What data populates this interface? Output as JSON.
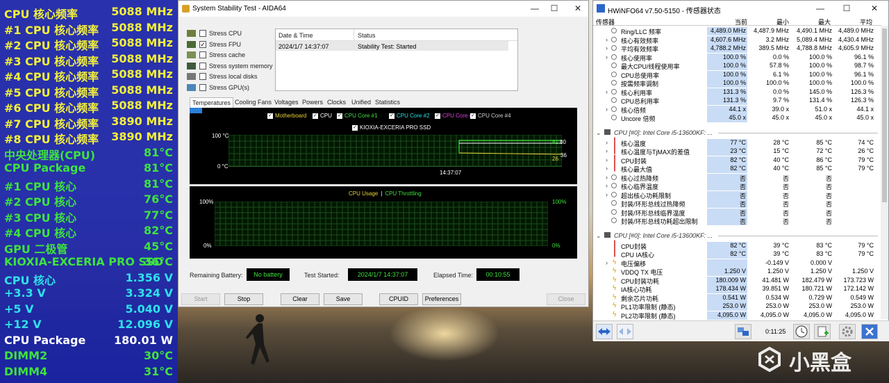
{
  "osd": [
    {
      "label": "CPU 核心频率",
      "value": "5088 MHz",
      "color": "yellow"
    },
    {
      "label": "#1 CPU 核心频率",
      "value": "5088 MHz",
      "color": "yellow"
    },
    {
      "label": "#2 CPU 核心频率",
      "value": "5088 MHz",
      "color": "yellow"
    },
    {
      "label": "#3 CPU 核心频率",
      "value": "5088 MHz",
      "color": "yellow"
    },
    {
      "label": "#4 CPU 核心频率",
      "value": "5088 MHz",
      "color": "yellow"
    },
    {
      "label": "#5 CPU 核心频率",
      "value": "5088 MHz",
      "color": "yellow"
    },
    {
      "label": "#6 CPU 核心频率",
      "value": "5088 MHz",
      "color": "yellow"
    },
    {
      "label": "#7 CPU 核心频率",
      "value": "3890 MHz",
      "color": "yellow"
    },
    {
      "label": "#8 CPU 核心频率",
      "value": "3890 MHz",
      "color": "yellow"
    },
    {
      "label": "中央处理器(CPU)",
      "value": "81°C",
      "color": "green"
    },
    {
      "label": "CPU Package",
      "value": "81°C",
      "color": "green"
    },
    {
      "label": " #1 CPU 核心",
      "value": "81°C",
      "color": "green"
    },
    {
      "label": " #2 CPU 核心",
      "value": "76°C",
      "color": "green"
    },
    {
      "label": " #3 CPU 核心",
      "value": "77°C",
      "color": "green"
    },
    {
      "label": " #4 CPU 核心",
      "value": "82°C",
      "color": "green"
    },
    {
      "label": "GPU 二极管",
      "value": "45°C",
      "color": "green"
    },
    {
      "label": "KIOXIA-EXCERIA PRO SSD",
      "value": "36°C",
      "color": "green"
    },
    {
      "label": "CPU 核心",
      "value": "1.356 V",
      "color": "cyan"
    },
    {
      "label": "+3.3 V",
      "value": "3.324 V",
      "color": "cyan"
    },
    {
      "label": "+5 V",
      "value": "5.040 V",
      "color": "cyan"
    },
    {
      "label": "+12 V",
      "value": "12.096 V",
      "color": "cyan"
    },
    {
      "label": "CPU Package",
      "value": "180.01 W",
      "color": "white"
    },
    {
      "label": "DIMM2",
      "value": "30°C",
      "color": "green"
    },
    {
      "label": "DIMM4",
      "value": "31°C",
      "color": "green"
    }
  ],
  "aida": {
    "title": "System Stability Test - AIDA64",
    "win_min": "—",
    "win_max": "☐",
    "win_close": "✕",
    "stress": [
      {
        "label": "Stress CPU",
        "checked": false
      },
      {
        "label": "Stress FPU",
        "checked": true
      },
      {
        "label": "Stress cache",
        "checked": false
      },
      {
        "label": "Stress system memory",
        "checked": false
      },
      {
        "label": "Stress local disks",
        "checked": false
      },
      {
        "label": "Stress GPU(s)",
        "checked": false
      }
    ],
    "table": {
      "col_date": "Date & Time",
      "col_status": "Status",
      "row_date": "2024/1/7 14:37:07",
      "row_status": "Stability Test: Started"
    },
    "tabs": [
      "Temperatures",
      "Cooling Fans",
      "Voltages",
      "Powers",
      "Clocks",
      "Unified",
      "Statistics"
    ],
    "temp_graph": {
      "legend": [
        "Motherboard",
        "CPU",
        "CPU Core #1",
        "CPU Core #2",
        "CPU Core #3",
        "CPU Core #4"
      ],
      "legend2": "KIOXIA-EXCERIA PRO SSD",
      "y_top": "100 °C",
      "y_bottom": "0 °C",
      "time": "14:37:07",
      "val_hi": "81",
      "val_hi2": "80",
      "val_lo": "26",
      "val_lo2": "36"
    },
    "cpu_graph": {
      "label_usage": "CPU Usage",
      "sep": "|",
      "label_throttle": "CPU Throttling",
      "y_top": "100%",
      "y_bottom": "0%",
      "r_top": "100%",
      "r_bottom": "0%"
    },
    "status": {
      "battery_label": "Remaining Battery:",
      "battery_value": "No battery",
      "started_label": "Test Started:",
      "started_value": "2024/1/7 14:37:07",
      "elapsed_label": "Elapsed Time:",
      "elapsed_value": "00:10:55"
    },
    "buttons": {
      "start": "Start",
      "stop": "Stop",
      "clear": "Clear",
      "save": "Save",
      "cpuid": "CPUID",
      "prefs": "Preferences",
      "close": "Close"
    }
  },
  "hwinfo": {
    "title": "HWiNFO64 v7.50-5150 - 传感器状态",
    "win_min": "—",
    "win_max": "☐",
    "win_close": "✕",
    "header": {
      "sensor": "传感器",
      "current": "当前",
      "min": "最小",
      "max": "最大",
      "avg": "平均"
    },
    "group1": [
      {
        "name": "Ring/LLC 频率",
        "cur": "4,489.0 MHz",
        "min": "4,487.9 MHz",
        "max": "4,490.1 MHz",
        "avg": "4,489.0 MHz"
      },
      {
        "name": "核心有效频率",
        "cur": "4,607.6 MHz",
        "min": "3.2 MHz",
        "max": "5,089.4 MHz",
        "avg": "4,430.4 MHz"
      },
      {
        "name": "平均有效频率",
        "cur": "4,788.2 MHz",
        "min": "389.5 MHz",
        "max": "4,788.8 MHz",
        "avg": "4,605.9 MHz"
      },
      {
        "name": "核心使用率",
        "cur": "100.0 %",
        "min": "0.0 %",
        "max": "100.0 %",
        "avg": "96.1 %"
      },
      {
        "name": "最大CPU/线程使用率",
        "cur": "100.0 %",
        "min": "57.8 %",
        "max": "100.0 %",
        "avg": "98.7 %"
      },
      {
        "name": "CPU总使用率",
        "cur": "100.0 %",
        "min": "6.1 %",
        "max": "100.0 %",
        "avg": "96.1 %"
      },
      {
        "name": "按需频率调制",
        "cur": "100.0 %",
        "min": "100.0 %",
        "max": "100.0 %",
        "avg": "100.0 %"
      },
      {
        "name": "核心利用率",
        "cur": "131.3 %",
        "min": "0.0 %",
        "max": "145.0 %",
        "avg": "126.3 %"
      },
      {
        "name": "CPU总利用率",
        "cur": "131.3 %",
        "min": "9.7 %",
        "max": "131.4 %",
        "avg": "126.3 %"
      },
      {
        "name": "核心倍频",
        "cur": "44.1 x",
        "min": "39.0 x",
        "max": "51.0 x",
        "avg": "44.1 x"
      },
      {
        "name": "Uncore 倍频",
        "cur": "45.0 x",
        "min": "45.0 x",
        "max": "45.0 x",
        "avg": "45.0 x"
      }
    ],
    "group2_title": "CPU [#0]: Intel Core i5-13600KF: ...",
    "group2": [
      {
        "name": "核心温度",
        "cur": "77 °C",
        "min": "28 °C",
        "max": "85 °C",
        "avg": "74 °C"
      },
      {
        "name": "核心温度与TjMAX的差值",
        "cur": "23 °C",
        "min": "15 °C",
        "max": "72 °C",
        "avg": "26 °C"
      },
      {
        "name": "CPU封装",
        "cur": "82 °C",
        "min": "40 °C",
        "max": "86 °C",
        "avg": "79 °C"
      },
      {
        "name": "核心最大值",
        "cur": "82 °C",
        "min": "40 °C",
        "max": "85 °C",
        "avg": "79 °C"
      },
      {
        "name": "核心过热降频",
        "cur": "否",
        "min": "否",
        "max": "否",
        "avg": ""
      },
      {
        "name": "核心临界温度",
        "cur": "否",
        "min": "否",
        "max": "否",
        "avg": ""
      },
      {
        "name": "超出核心功耗限制",
        "cur": "否",
        "min": "否",
        "max": "否",
        "avg": ""
      },
      {
        "name": "封装/环形总线过热降频",
        "cur": "否",
        "min": "否",
        "max": "否",
        "avg": ""
      },
      {
        "name": "封装/环形总线临界温度",
        "cur": "否",
        "min": "否",
        "max": "否",
        "avg": ""
      },
      {
        "name": "封装/环形总线功耗超出限制",
        "cur": "否",
        "min": "否",
        "max": "否",
        "avg": ""
      }
    ],
    "group3_title": "CPU [#0]: Intel Core i5-13600KF: ...",
    "group3": [
      {
        "name": "CPU封装",
        "cur": "82 °C",
        "min": "39 °C",
        "max": "83 °C",
        "avg": "79 °C"
      },
      {
        "name": "CPU IA核心",
        "cur": "82 °C",
        "min": "39 °C",
        "max": "83 °C",
        "avg": "79 °C"
      },
      {
        "name": "电压偏移",
        "cur": "",
        "min": "-0.149 V",
        "max": "0.000 V",
        "avg": ""
      },
      {
        "name": "VDDQ TX 电压",
        "cur": "1.250 V",
        "min": "1.250 V",
        "max": "1.250 V",
        "avg": "1.250 V"
      },
      {
        "name": "CPU封装功耗",
        "cur": "180.009 W",
        "min": "41.481 W",
        "max": "182.479 W",
        "avg": "173.723 W"
      },
      {
        "name": "IA核心功耗",
        "cur": "178.434 W",
        "min": "39.851 W",
        "max": "180.721 W",
        "avg": "172.142 W"
      },
      {
        "name": "剩余芯片功耗",
        "cur": "0.541 W",
        "min": "0.534 W",
        "max": "0.729 W",
        "avg": "0.549 W"
      },
      {
        "name": "PL1功率限制 (静态)",
        "cur": "253.0 W",
        "min": "253.0 W",
        "max": "253.0 W",
        "avg": "253.0 W"
      },
      {
        "name": "PL2功率限制 (静态)",
        "cur": "4,095.0 W",
        "min": "4,095.0 W",
        "max": "4,095.0 W",
        "avg": "4,095.0 W"
      }
    ],
    "elapsed": "0:11:25"
  },
  "watermark": "小黑盒",
  "colors": {
    "osd_bg": "#1a24a8",
    "yellow": "#f3f03a",
    "green": "#3ee23e",
    "cyan": "#2fe0ea",
    "graph_green": "#3ee23e",
    "hl": "#c9dcf5"
  }
}
